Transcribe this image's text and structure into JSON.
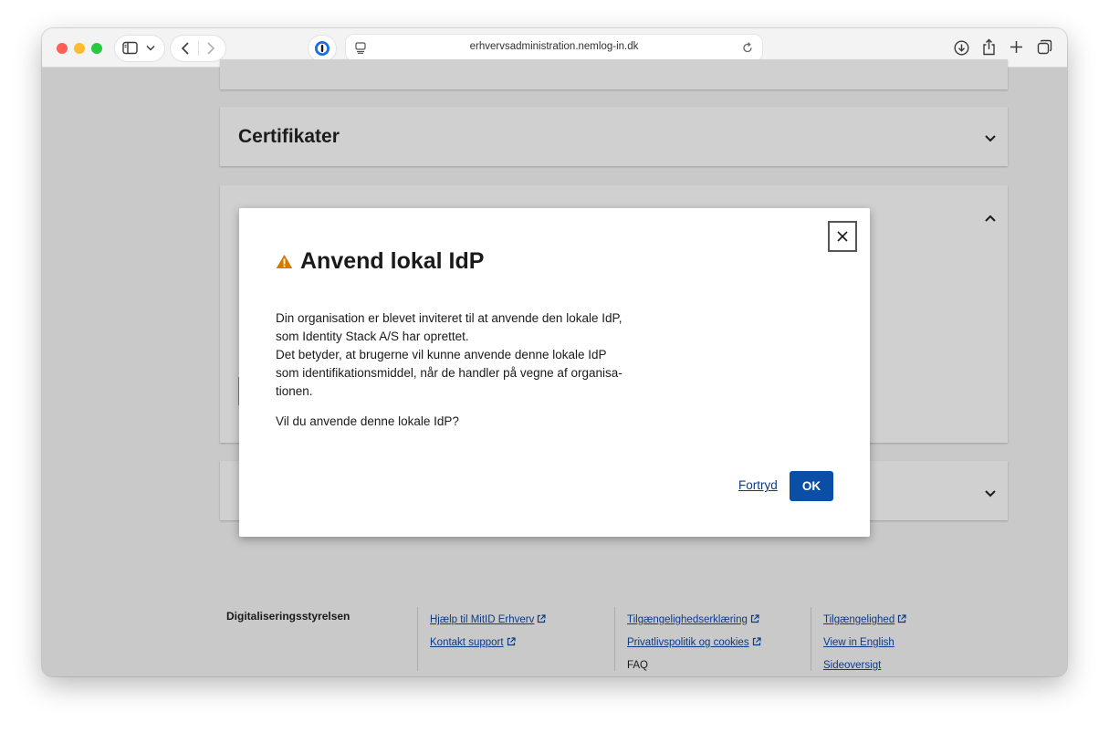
{
  "browser": {
    "url": "erhvervsadministration.nemlog-in.dk"
  },
  "page": {
    "panels": {
      "certifikater_title": "Certifikater"
    },
    "footer": {
      "org": "Digitaliseringsstyrelsen",
      "col1": [
        "Hjælp til MitID Erhverv",
        "Kontakt support"
      ],
      "col2": [
        "Tilgængelighedserklæring",
        "Privatlivspolitik og cookies",
        "FAQ"
      ],
      "col3": [
        "Tilgængelighed",
        "View in English",
        "Sideoversigt"
      ]
    }
  },
  "modal": {
    "title": "Anvend lokal IdP",
    "warning_color": "#d47a00",
    "body_lines": [
      "Din organisation er blevet inviteret til at anvende den lokale IdP,",
      "som Identity Stack A/S har oprettet.",
      "Det betyder, at brugerne vil kunne anvende denne lokale IdP",
      "som identifikationsmiddel, når de handler på vegne af organisa-",
      "tionen."
    ],
    "question": "Vil du anvende denne lokale IdP?",
    "cancel_label": "Fortryd",
    "ok_label": "OK",
    "ok_color": "#0a4ea6"
  }
}
